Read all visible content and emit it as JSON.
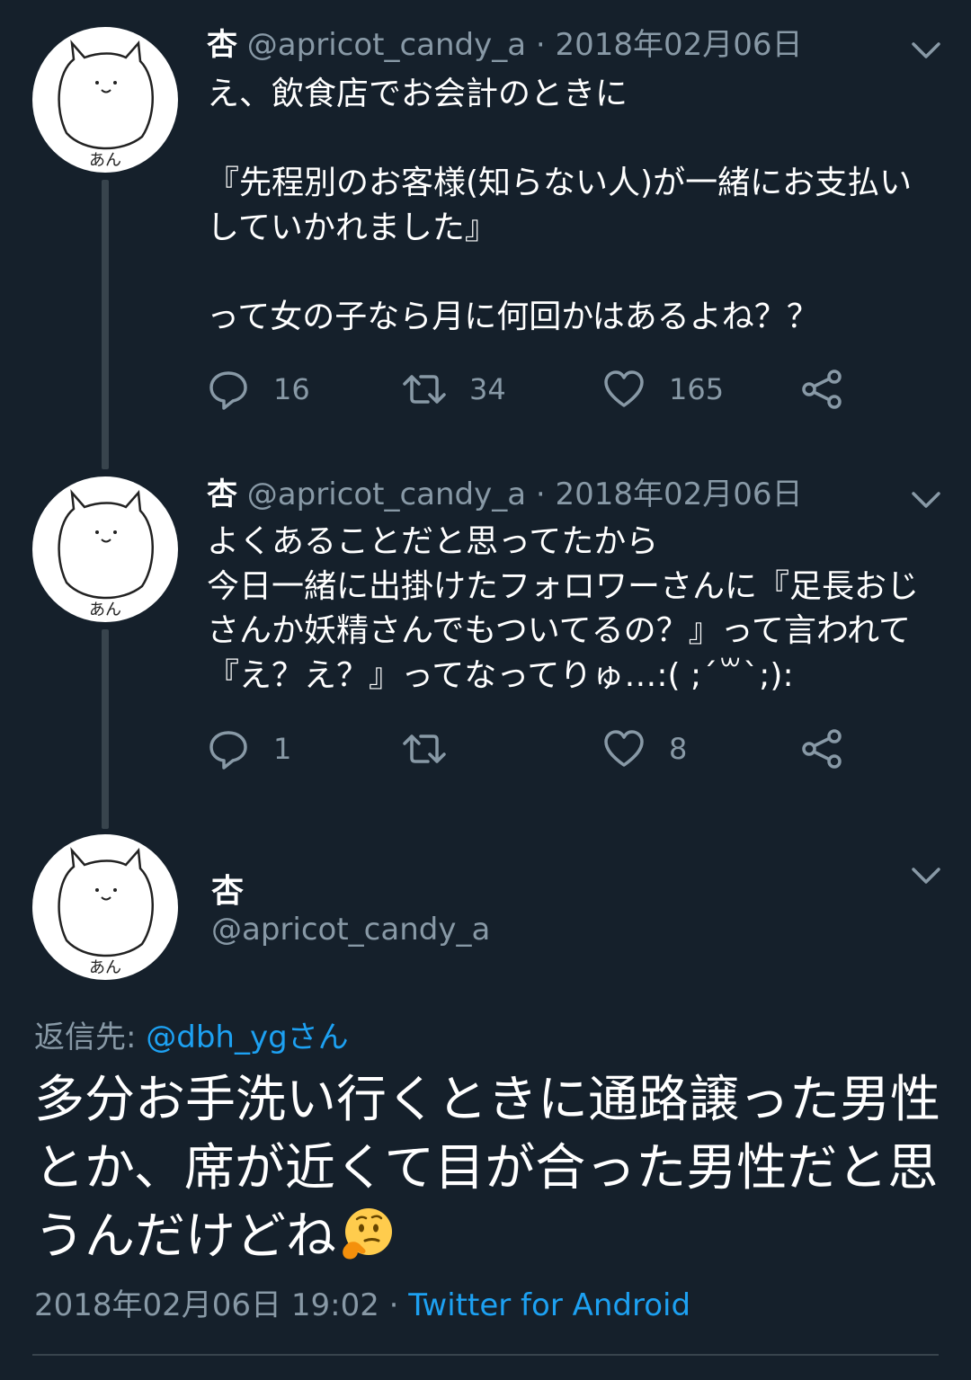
{
  "thread": [
    {
      "name": "杏",
      "meta": " @apricot_candy_a · 2018年02月06日",
      "avatar_label": "あん",
      "text": "え、飲食店でお会計のときに\n\n『先程別のお客様(知らない人)が一緒にお支払いしていかれました』\n\nって女の子なら月に何回かはあるよね？？",
      "reply_count": "16",
      "retweet_count": "34",
      "like_count": "165"
    },
    {
      "name": "杏",
      "meta": " @apricot_candy_a · 2018年02月06日",
      "avatar_label": "あん",
      "text": "よくあることだと思ってたから\n今日一緒に出掛けたフォロワーさんに『足長おじさんか妖精さんでもついてるの？』って言われて『え？え？』ってなってりゅ…:( ;´꒳`;):",
      "reply_count": "1",
      "retweet_count": "",
      "like_count": "8"
    }
  ],
  "main": {
    "avatar_label": "あん",
    "name": "杏",
    "handle": "@apricot_candy_a",
    "reply_prefix": "返信先: ",
    "reply_mention": "@dbh_ygさん",
    "text": "多分お手洗い行くときに通路譲った男性とか、席が近くて目が合った男性だと思うんだけどね",
    "emoji": "thinking-face",
    "timestamp": "2018年02月06日 19:02 · ",
    "source": "Twitter for Android"
  },
  "colors": {
    "background": "#15202b",
    "text": "#ffffff",
    "secondary": "#8899a6",
    "link": "#1da1f2",
    "line": "#38444d"
  }
}
